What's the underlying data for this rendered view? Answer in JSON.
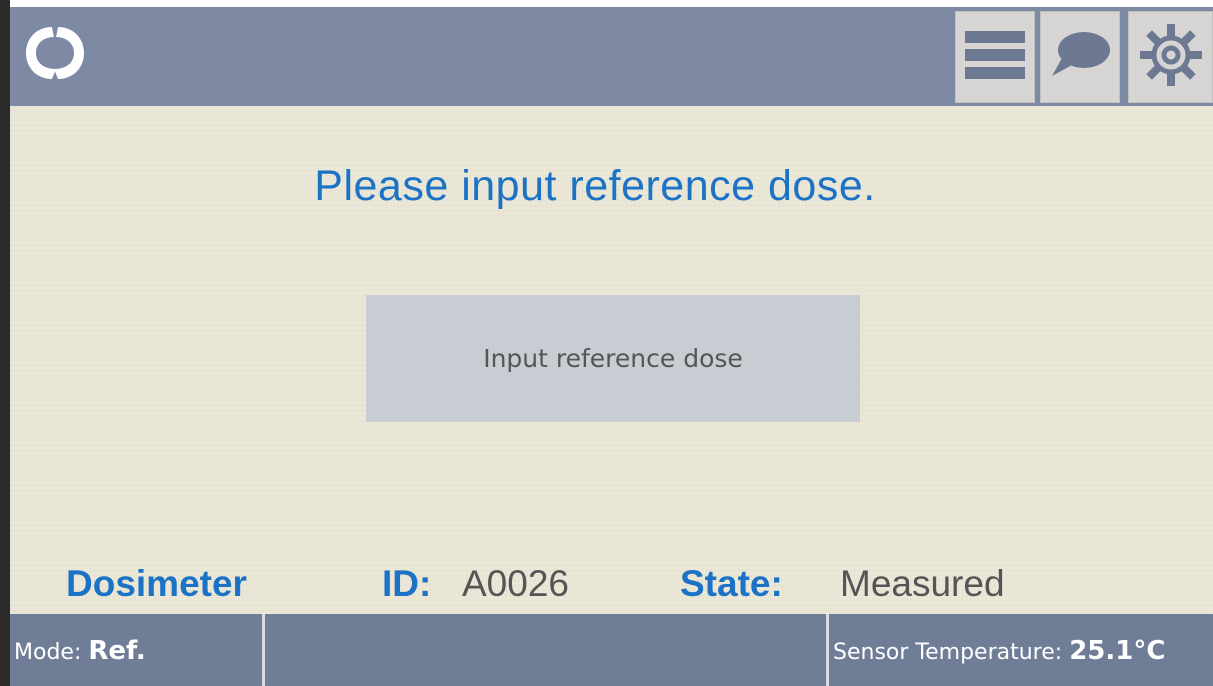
{
  "header": {
    "logo_icon": "app-logo-icon",
    "buttons": [
      {
        "name": "menu",
        "icon": "hamburger-menu-icon"
      },
      {
        "name": "messages",
        "icon": "speech-bubble-icon"
      },
      {
        "name": "settings",
        "icon": "gear-icon"
      }
    ]
  },
  "main": {
    "prompt": "Please input reference dose.",
    "input_button_label": "Input reference dose"
  },
  "info": {
    "dosimeter_label": "Dosimeter",
    "id_label": "ID:",
    "id_value": "A0026",
    "state_label": "State:",
    "state_value": "Measured"
  },
  "status_bar": {
    "mode_label": "Mode:",
    "mode_value": "Ref.",
    "temp_label": "Sensor Temperature:",
    "temp_value": "25.1°C"
  },
  "colors": {
    "accent_text": "#1c73c6",
    "topbar": "#7e8aa3",
    "statusbar": "#707d97",
    "screen_bg": "#ebe8d8"
  }
}
